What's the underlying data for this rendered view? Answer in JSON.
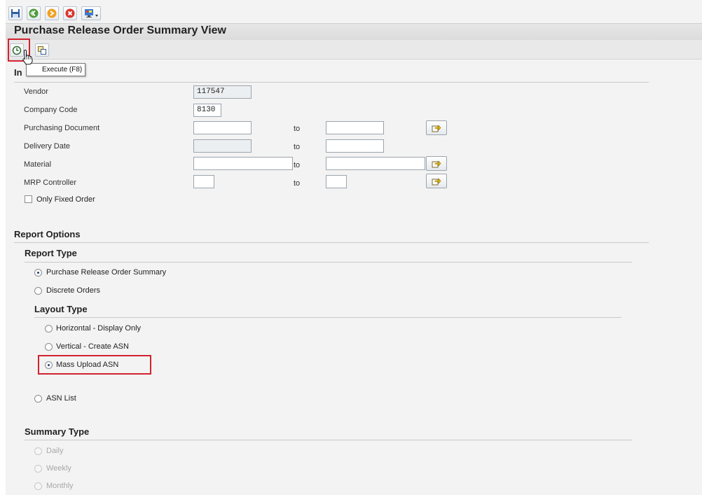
{
  "window": {
    "title": "Purchase Release Order Summary View"
  },
  "toolbar": {
    "icons": [
      "save-icon",
      "back-icon",
      "exit-icon",
      "cancel-icon",
      "layout-menu-icon"
    ]
  },
  "app_toolbar": {
    "execute_icon": "execute-clock-icon",
    "variant_icon": "get-variant-icon",
    "tooltip": "Execute (F8)"
  },
  "input_section": {
    "title": "In",
    "fields": {
      "vendor": {
        "label": "Vendor",
        "value": "117547"
      },
      "company_code": {
        "label": "Company Code",
        "value": "8130"
      },
      "purchasing_document": {
        "label": "Purchasing Document",
        "from": "",
        "to": ""
      },
      "delivery_date": {
        "label": "Delivery Date",
        "from": "",
        "to": ""
      },
      "material": {
        "label": "Material",
        "from": "",
        "to": ""
      },
      "mrp_controller": {
        "label": "MRP Controller",
        "from": "",
        "to": ""
      }
    },
    "to_label": "to",
    "only_fixed_order": {
      "label": "Only Fixed Order",
      "checked": false
    }
  },
  "report_options": {
    "title": "Report Options",
    "report_type": {
      "title": "Report Type",
      "options": [
        {
          "label": "Purchase Release Order Summary",
          "checked": true
        },
        {
          "label": "Discrete Orders",
          "checked": false
        }
      ]
    },
    "layout_type": {
      "title": "Layout Type",
      "options": [
        {
          "label": "Horizontal - Display Only",
          "checked": false
        },
        {
          "label": "Vertical - Create ASN",
          "checked": false
        },
        {
          "label": "Mass Upload ASN",
          "checked": true
        }
      ]
    },
    "asn_list": {
      "label": "ASN List",
      "checked": false
    },
    "summary_type": {
      "title": "Summary Type",
      "options": [
        {
          "label": "Daily",
          "disabled": true
        },
        {
          "label": "Weekly",
          "disabled": true
        },
        {
          "label": "Monthly",
          "disabled": true
        }
      ]
    }
  },
  "colors": {
    "highlight": "#d0232f",
    "radio_dot": "#1f3f78"
  }
}
